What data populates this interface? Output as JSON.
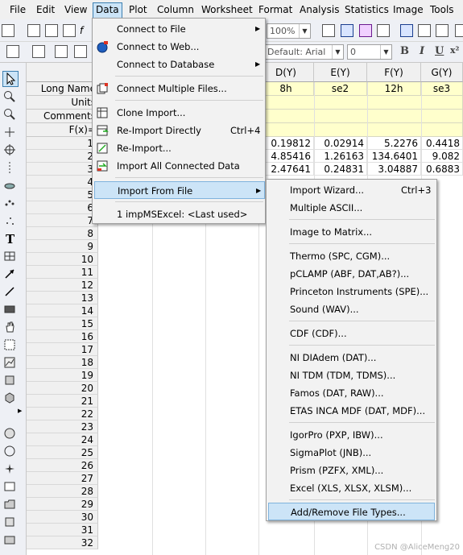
{
  "menubar": {
    "items": [
      "File",
      "Edit",
      "View",
      "Data",
      "Plot",
      "Column",
      "Worksheet",
      "Format",
      "Analysis",
      "Statistics",
      "Image",
      "Tools"
    ],
    "active": "Data"
  },
  "toolbar": {
    "zoom_value": "100%",
    "font_value": "Default: Arial",
    "font_size_value": "0",
    "bold_label": "B",
    "italic_label": "I",
    "underline_label": "U",
    "superscript_label": "x²"
  },
  "worksheet": {
    "row_headers": [
      "Long Name",
      "Units",
      "Comments",
      "F(x)="
    ],
    "columns": [
      {
        "name": "D(Y)",
        "long_name": "8h"
      },
      {
        "name": "E(Y)",
        "long_name": "se2"
      },
      {
        "name": "F(Y)",
        "long_name": "12h"
      },
      {
        "name": "G(Y)",
        "long_name": "se3"
      }
    ],
    "rows": [
      {
        "num": "1",
        "cells": [
          "0.19812",
          "0.02914",
          "5.2276",
          "0.4418"
        ]
      },
      {
        "num": "2",
        "cells": [
          "4.85416",
          "1.26163",
          "134.6401",
          "9.082"
        ]
      },
      {
        "num": "3",
        "cells": [
          "2.47641",
          "0.24831",
          "3.04887",
          "0.6883"
        ]
      },
      {
        "num": "4",
        "cells": [
          "",
          "",
          "",
          ""
        ]
      },
      {
        "num": "5",
        "cells": [
          "",
          "",
          "",
          ""
        ]
      },
      {
        "num": "6",
        "cells": [
          "",
          "",
          "",
          ""
        ]
      },
      {
        "num": "7",
        "cells": [
          "",
          "",
          "",
          ""
        ]
      },
      {
        "num": "8",
        "cells": [
          "",
          "",
          "",
          ""
        ]
      },
      {
        "num": "9",
        "cells": [
          "",
          "",
          "",
          ""
        ]
      },
      {
        "num": "10",
        "cells": [
          "",
          "",
          "",
          ""
        ]
      },
      {
        "num": "11",
        "cells": [
          "",
          "",
          "",
          ""
        ]
      },
      {
        "num": "12",
        "cells": [
          "",
          "",
          "",
          ""
        ]
      },
      {
        "num": "13",
        "cells": [
          "",
          "",
          "",
          ""
        ]
      },
      {
        "num": "14",
        "cells": [
          "",
          "",
          "",
          ""
        ]
      },
      {
        "num": "15",
        "cells": [
          "",
          "",
          "",
          ""
        ]
      },
      {
        "num": "16",
        "cells": [
          "",
          "",
          "",
          ""
        ]
      },
      {
        "num": "17",
        "cells": [
          "",
          "",
          "",
          ""
        ]
      },
      {
        "num": "18",
        "cells": [
          "",
          "",
          "",
          ""
        ]
      },
      {
        "num": "19",
        "cells": [
          "",
          "",
          "",
          ""
        ]
      },
      {
        "num": "20",
        "cells": [
          "",
          "",
          "",
          ""
        ]
      },
      {
        "num": "21",
        "cells": [
          "",
          "",
          "",
          ""
        ]
      },
      {
        "num": "22",
        "cells": [
          "",
          "",
          "",
          ""
        ]
      },
      {
        "num": "23",
        "cells": [
          "",
          "",
          "",
          ""
        ]
      },
      {
        "num": "24",
        "cells": [
          "",
          "",
          "",
          ""
        ]
      },
      {
        "num": "25",
        "cells": [
          "",
          "",
          "",
          ""
        ]
      },
      {
        "num": "26",
        "cells": [
          "",
          "",
          "",
          ""
        ]
      },
      {
        "num": "27",
        "cells": [
          "",
          "",
          "",
          ""
        ]
      },
      {
        "num": "28",
        "cells": [
          "",
          "",
          "",
          ""
        ]
      },
      {
        "num": "29",
        "cells": [
          "",
          "",
          "",
          ""
        ]
      },
      {
        "num": "30",
        "cells": [
          "",
          "",
          "",
          ""
        ]
      },
      {
        "num": "31",
        "cells": [
          "",
          "",
          "",
          ""
        ]
      },
      {
        "num": "32",
        "cells": [
          "",
          "",
          "",
          ""
        ]
      }
    ]
  },
  "data_menu": {
    "items": [
      {
        "label": "Connect to File",
        "submenu": true,
        "icon": ""
      },
      {
        "label": "Connect to Web...",
        "submenu": false,
        "icon": "globe-icon"
      },
      {
        "label": "Connect to Database",
        "submenu": true,
        "icon": ""
      },
      {
        "label": "Connect Multiple Files...",
        "submenu": false,
        "icon": "multiple-files-icon"
      },
      {
        "label": "Clone Import...",
        "submenu": false,
        "icon": "clone-import-icon"
      },
      {
        "label": "Re-Import Directly",
        "shortcut": "Ctrl+4",
        "submenu": false,
        "icon": "reimport-direct-icon"
      },
      {
        "label": "Re-Import...",
        "submenu": false,
        "icon": "reimport-icon"
      },
      {
        "label": "Import All Connected Data",
        "submenu": false,
        "icon": "import-all-icon"
      },
      {
        "label": "Import From File",
        "submenu": true,
        "icon": "",
        "highlighted": true
      },
      {
        "label": "1 impMSExcel: <Last used>",
        "submenu": false,
        "icon": ""
      }
    ]
  },
  "import_submenu": {
    "items": [
      {
        "label": "Import Wizard...",
        "shortcut": "Ctrl+3"
      },
      {
        "label": "Multiple ASCII..."
      },
      {
        "label": "Image to Matrix..."
      },
      {
        "label": "Thermo (SPC, CGM)..."
      },
      {
        "label": "pCLAMP (ABF, DAT,AB?)..."
      },
      {
        "label": "Princeton Instruments (SPE)..."
      },
      {
        "label": "Sound (WAV)..."
      },
      {
        "label": "CDF (CDF)..."
      },
      {
        "label": "NI DIAdem (DAT)..."
      },
      {
        "label": "NI TDM (TDM, TDMS)..."
      },
      {
        "label": "Famos (DAT, RAW)..."
      },
      {
        "label": "ETAS INCA MDF (DAT, MDF)..."
      },
      {
        "label": "IgorPro (PXP, IBW)..."
      },
      {
        "label": "SigmaPlot (JNB)..."
      },
      {
        "label": "Prism (PZFX, XML)..."
      },
      {
        "label": "Excel (XLS, XLSX, XLSM)..."
      },
      {
        "label": "Add/Remove File Types...",
        "highlighted": true
      }
    ]
  },
  "watermark": "CSDN @AliceMeng20",
  "colors": {
    "menu_highlight": "#cce4f7",
    "sheet_header_yellow": "#ffffcc",
    "menu_background": "#f2f2f2"
  }
}
